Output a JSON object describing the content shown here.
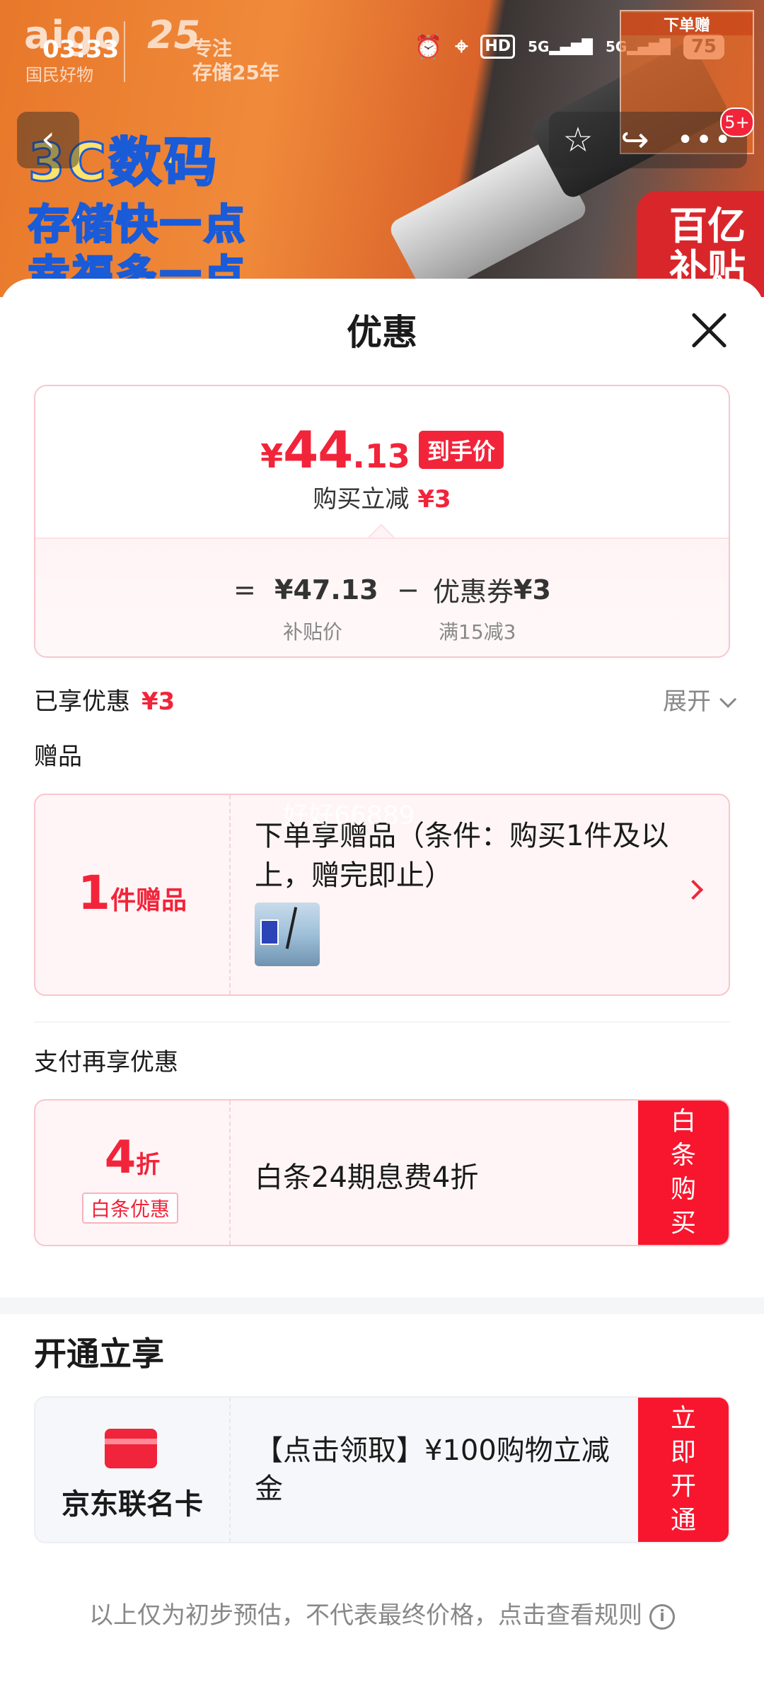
{
  "status_bar": {
    "time": "03:33",
    "hd_label": "HD",
    "signal_1": "5G",
    "signal_2": "5G",
    "battery": "75"
  },
  "background": {
    "brand_logo": "aigo",
    "brand_sub": "国民好物",
    "brand_25": "25",
    "brand_25_sub": "专注\n存储25年",
    "promo_line1": "3C数码",
    "promo_line2": "存储快一点",
    "promo_line3": "幸福多一点",
    "subsidy_badge": "百亿\n补贴",
    "gift_thumb_label": "下单赠",
    "notification_badge": "5+"
  },
  "sheet": {
    "title": "优惠",
    "price_card": {
      "currency": "¥",
      "price_int": "44",
      "price_dec": ".13",
      "final_tag": "到手价",
      "reduce_label": "购买立减",
      "reduce_value": "¥3",
      "equals": "=",
      "subsidy_price": "¥47.13",
      "minus": "−",
      "coupon_label": "优惠券",
      "coupon_value": "¥3",
      "subsidy_price_label": "补贴价",
      "coupon_rule": "满15减3"
    },
    "enjoyed_label": "已享优惠",
    "enjoyed_value": "¥3",
    "expand_label": "展开",
    "gift_section_label": "赠品",
    "gift_card": {
      "count": "1",
      "unit": "件赠品",
      "title": "下单享赠品（条件：购买1件及以上，赠完即止）"
    },
    "pay_section_label": "支付再享优惠",
    "pay_card": {
      "discount_num": "4",
      "discount_unit": "折",
      "tag": "白条优惠",
      "title": "白条24期息费4折",
      "button": "白条购买"
    },
    "open_section_title": "开通立享",
    "jd_card": {
      "name": "京东联名卡",
      "title": "【点击领取】¥100购物立减金",
      "button": "立即开通"
    },
    "footer_note": "以上仅为初步预估，不代表最终价格，点击查看规则",
    "watermark": "好好66889"
  },
  "colors": {
    "accent_red": "#f2243a",
    "button_red": "#f7162e",
    "card_bg_pink": "#fff5f6",
    "muted_text": "#888888"
  }
}
